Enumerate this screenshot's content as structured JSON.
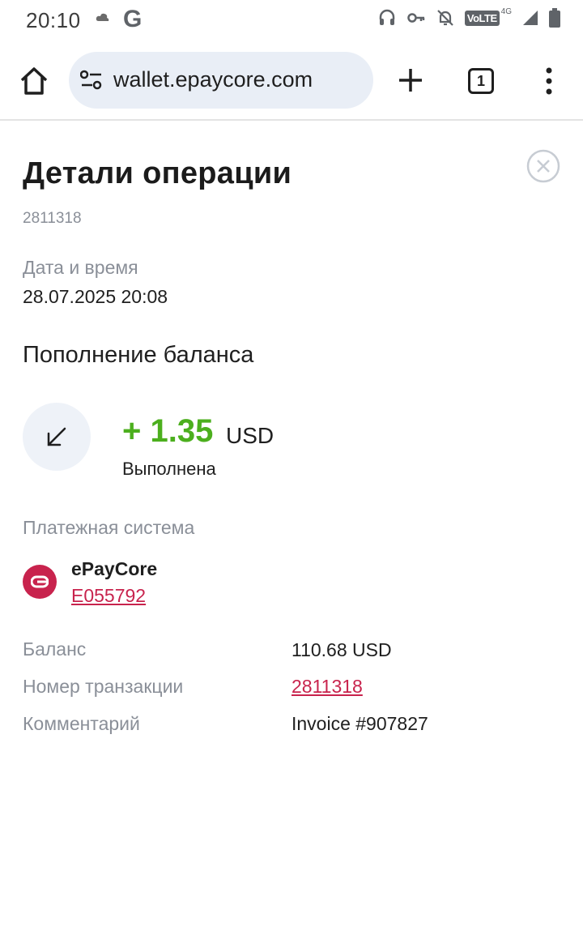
{
  "status_bar": {
    "time": "20:10",
    "volte": "VoLTE",
    "network": "4G"
  },
  "browser": {
    "url": "wallet.epaycore.com",
    "tab_count": "1"
  },
  "details": {
    "title": "Детали операции",
    "operation_id": "2811318",
    "datetime_label": "Дата и время",
    "datetime_value": "28.07.2025 20:08",
    "operation_type": "Пополнение баланса",
    "amount": "+ 1.35",
    "currency": "USD",
    "status": "Выполнена",
    "payment_system_label": "Платежная система",
    "payment_system_name": "ePayCore",
    "payment_system_account": "E055792",
    "rows": [
      {
        "label": "Баланс",
        "value": "110.68 USD"
      },
      {
        "label": "Номер транзакции",
        "value": "2811318"
      },
      {
        "label": "Комментарий",
        "value": "Invoice #907827"
      }
    ]
  },
  "colors": {
    "amount_green": "#4caf1e",
    "brand_red": "#c8234d",
    "muted_gray": "#8a8f98"
  },
  "icons": [
    "cloud-icon",
    "google-g-icon",
    "headset-icon",
    "key-icon",
    "bell-off-icon",
    "signal-icon",
    "battery-icon",
    "home-icon",
    "site-settings-icon",
    "plus-icon",
    "more-vert-icon",
    "close-icon",
    "arrow-down-left-icon",
    "epaycore-logo-icon"
  ]
}
